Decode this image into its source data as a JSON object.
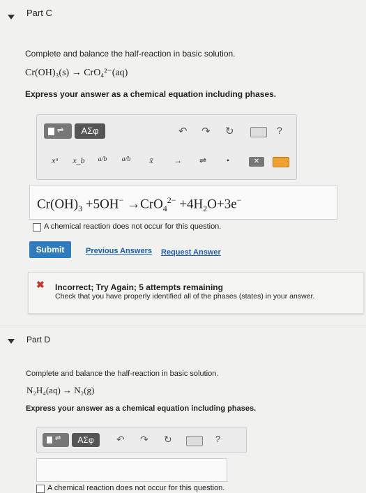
{
  "part_c": {
    "title": "Part C",
    "instruction": "Complete and balance the half-reaction in basic solution.",
    "reaction": "Cr(OH)₃(s) → CrO₄²⁻(aq)",
    "express": "Express your answer as a chemical equation including phases.",
    "toolbar": {
      "greek_label": "ΑΣφ",
      "help_label": "?",
      "sym_sup": "xᵃ",
      "sym_sub": "x_b",
      "sym_frac": "a/b",
      "sym_vec": "x̄",
      "sym_arrow": "→",
      "sym_equil": "⇌",
      "sym_dot": "•"
    },
    "answer": {
      "t1": "Cr(OH)",
      "s1": "3",
      "t2": "+5OH",
      "sup1": "−",
      "t3": "→CrO",
      "s2": "4",
      "sup2": "2−",
      "t4": "+4H",
      "s3": "2",
      "t5": "O+3e",
      "sup3": "−"
    },
    "no_reaction_label": "A chemical reaction does not occur for this question.",
    "submit_label": "Submit",
    "previous_answers_label": "Previous Answers",
    "request_answer_label": "Request Answer",
    "feedback": {
      "icon": "✖",
      "title": "Incorrect; Try Again; 5 attempts remaining",
      "message": "Check that you have properly identified all of the phases (states) in your answer."
    }
  },
  "part_d": {
    "title": "Part D",
    "instruction": "Complete and balance the half-reaction in basic solution.",
    "reaction": "N₂H₄(aq) → N₂(g)",
    "express": "Express your answer as a chemical equation including phases.",
    "toolbar": {
      "greek_label": "ΑΣφ",
      "help_label": "?"
    },
    "no_reaction_label": "A chemical reaction does not occur for this question."
  },
  "colors": {
    "accent": "#2f7bbd",
    "link": "#1a5fb4",
    "error": "#c0392b",
    "background": "#f1f1ef"
  }
}
